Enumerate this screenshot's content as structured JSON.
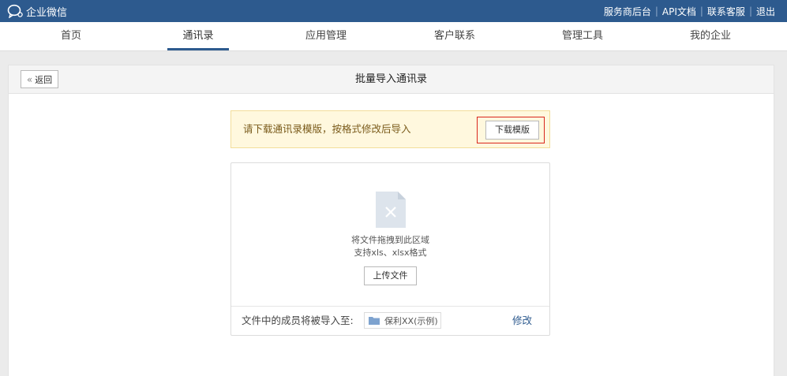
{
  "app": {
    "name": "企业微信"
  },
  "toplinks": [
    "服务商后台",
    "API文档",
    "联系客服",
    "退出"
  ],
  "nav": {
    "items": [
      "首页",
      "通讯录",
      "应用管理",
      "客户联系",
      "管理工具",
      "我的企业"
    ],
    "active": "通讯录"
  },
  "panel": {
    "back_label": "返回",
    "title": "批量导入通讯录"
  },
  "notice": {
    "text": "请下载通讯录模版，按格式修改后导入",
    "download_label": "下载模版"
  },
  "upload": {
    "drop_hint": "将文件拖拽到此区域",
    "formats_hint": "支持xls、xlsx格式",
    "button_label": "上传文件",
    "import_to_label": "文件中的成员将被导入至:",
    "department": "保利XX(示例)",
    "edit_label": "修改"
  },
  "colors": {
    "topbar": "#2d5a8e",
    "notice_bg": "#fff8de",
    "highlight": "#d9261c"
  }
}
